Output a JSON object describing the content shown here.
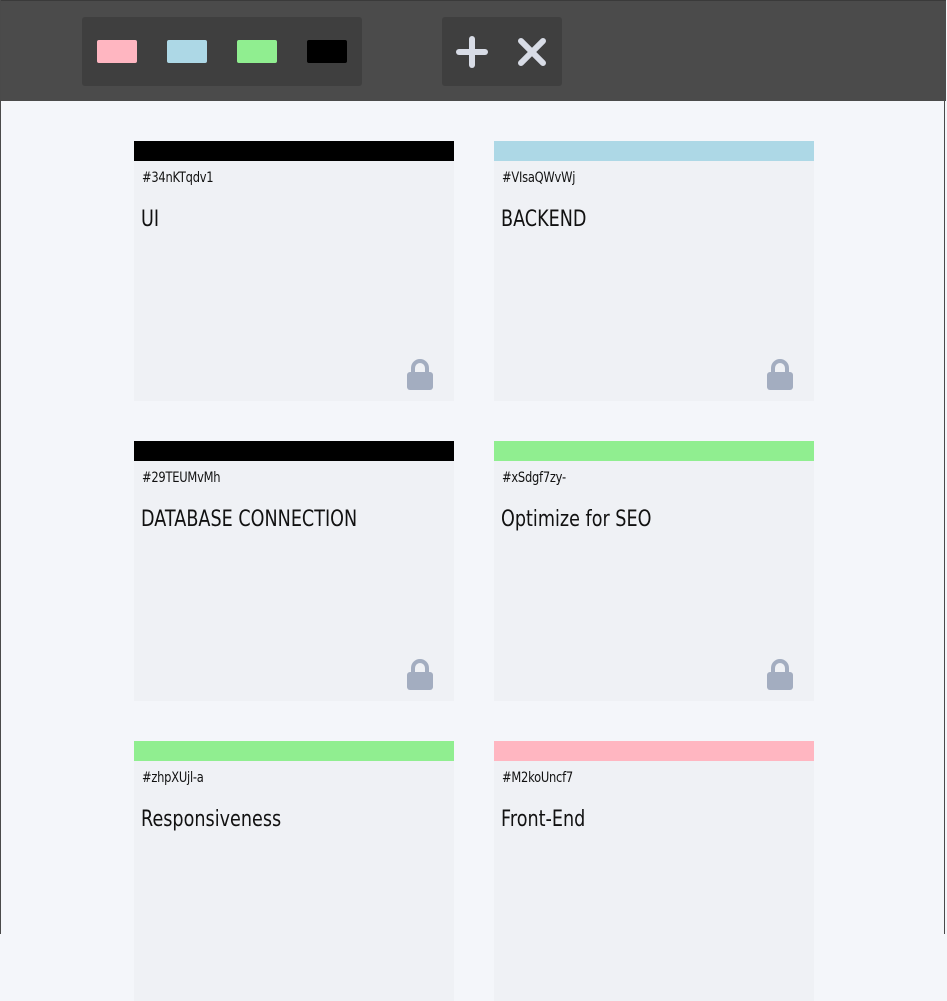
{
  "toolbar": {
    "colors": [
      {
        "name": "pink",
        "hex": "#ffb6c1"
      },
      {
        "name": "light-blue",
        "hex": "#add8e6"
      },
      {
        "name": "light-green",
        "hex": "#90ee90"
      },
      {
        "name": "black",
        "hex": "#000000"
      }
    ],
    "actions": [
      {
        "icon": "plus-icon"
      },
      {
        "icon": "close-icon"
      }
    ]
  },
  "notes": [
    {
      "id": "#34nKTqdv1",
      "title": "UI",
      "color": "#000000",
      "locked": true
    },
    {
      "id": "#VIsaQWvWj",
      "title": "BACKEND",
      "color": "#add8e6",
      "locked": true
    },
    {
      "id": "#29TEUMvMh",
      "title": "DATABASE CONNECTION",
      "color": "#000000",
      "locked": true
    },
    {
      "id": "#xSdgf7zy-",
      "title": "Optimize for SEO",
      "color": "#90ee90",
      "locked": true
    },
    {
      "id": "#zhpXUjl-a",
      "title": "Responsiveness",
      "color": "#90ee90",
      "locked": false
    },
    {
      "id": "#M2koUncf7",
      "title": "Front-End",
      "color": "#ffb6c1",
      "locked": false
    }
  ],
  "icons": {
    "lock": "lock-icon"
  }
}
